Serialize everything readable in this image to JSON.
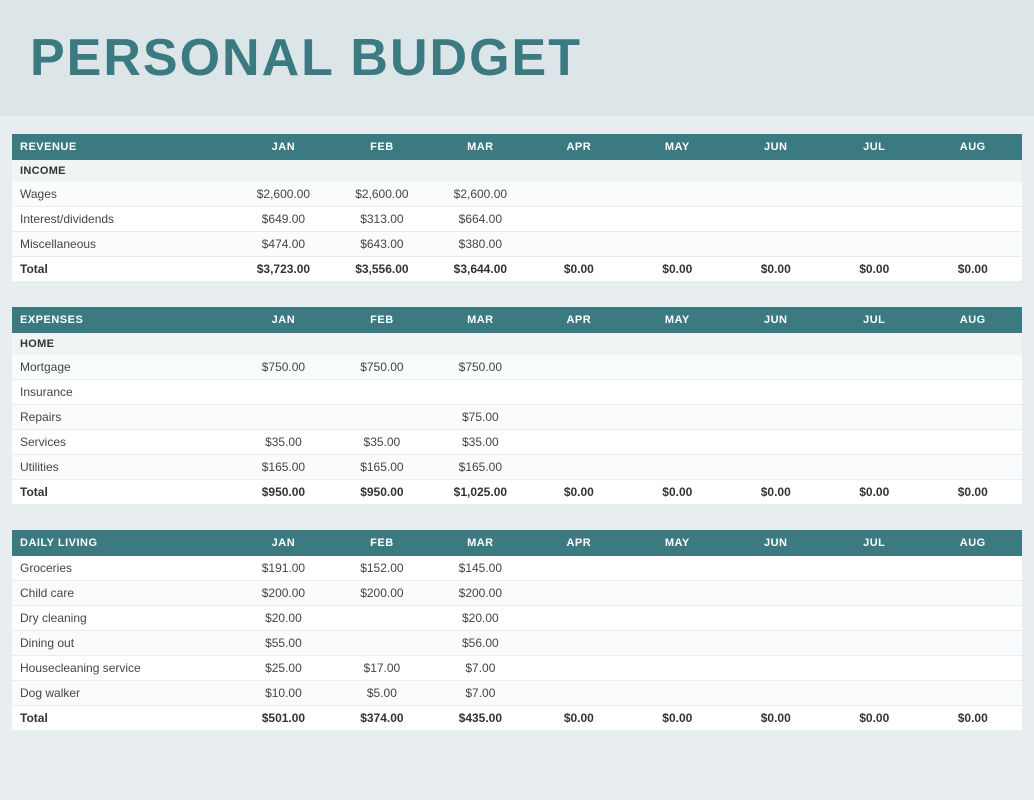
{
  "title": "PERSONAL BUDGET",
  "revenue": {
    "section_label": "REVENUE",
    "columns": [
      "REVENUE",
      "JAN",
      "FEB",
      "MAR",
      "APR",
      "MAY",
      "JUN",
      "JUL",
      "AUG"
    ],
    "income_subheader": "INCOME",
    "rows": [
      {
        "label": "Wages",
        "jan": "$2,600.00",
        "feb": "$2,600.00",
        "mar": "$2,600.00",
        "apr": "",
        "may": "",
        "jun": "",
        "jul": "",
        "aug": ""
      },
      {
        "label": "Interest/dividends",
        "jan": "$649.00",
        "feb": "$313.00",
        "mar": "$664.00",
        "apr": "",
        "may": "",
        "jun": "",
        "jul": "",
        "aug": ""
      },
      {
        "label": "Miscellaneous",
        "jan": "$474.00",
        "feb": "$643.00",
        "mar": "$380.00",
        "apr": "",
        "may": "",
        "jun": "",
        "jul": "",
        "aug": ""
      }
    ],
    "total": {
      "label": "Total",
      "jan": "$3,723.00",
      "feb": "$3,556.00",
      "mar": "$3,644.00",
      "apr": "$0.00",
      "may": "$0.00",
      "jun": "$0.00",
      "jul": "$0.00",
      "aug": "$0.00"
    }
  },
  "expenses": {
    "section_label": "EXPENSES",
    "columns": [
      "EXPENSES",
      "JAN",
      "FEB",
      "MAR",
      "APR",
      "MAY",
      "JUN",
      "JUL",
      "AUG"
    ],
    "home_subheader": "HOME",
    "rows": [
      {
        "label": "Mortgage",
        "jan": "$750.00",
        "feb": "$750.00",
        "mar": "$750.00",
        "apr": "",
        "may": "",
        "jun": "",
        "jul": "",
        "aug": ""
      },
      {
        "label": "Insurance",
        "jan": "",
        "feb": "",
        "mar": "",
        "apr": "",
        "may": "",
        "jun": "",
        "jul": "",
        "aug": ""
      },
      {
        "label": "Repairs",
        "jan": "",
        "feb": "",
        "mar": "$75.00",
        "apr": "",
        "may": "",
        "jun": "",
        "jul": "",
        "aug": ""
      },
      {
        "label": "Services",
        "jan": "$35.00",
        "feb": "$35.00",
        "mar": "$35.00",
        "apr": "",
        "may": "",
        "jun": "",
        "jul": "",
        "aug": ""
      },
      {
        "label": "Utilities",
        "jan": "$165.00",
        "feb": "$165.00",
        "mar": "$165.00",
        "apr": "",
        "may": "",
        "jun": "",
        "jul": "",
        "aug": ""
      }
    ],
    "total": {
      "label": "Total",
      "jan": "$950.00",
      "feb": "$950.00",
      "mar": "$1,025.00",
      "apr": "$0.00",
      "may": "$0.00",
      "jun": "$0.00",
      "jul": "$0.00",
      "aug": "$0.00"
    }
  },
  "daily_living": {
    "section_label": "DAILY LIVING",
    "columns": [
      "DAILY LIVING",
      "JAN",
      "FEB",
      "MAR",
      "APR",
      "MAY",
      "JUN",
      "JUL",
      "AUG"
    ],
    "rows": [
      {
        "label": "Groceries",
        "jan": "$191.00",
        "feb": "$152.00",
        "mar": "$145.00",
        "apr": "",
        "may": "",
        "jun": "",
        "jul": "",
        "aug": ""
      },
      {
        "label": "Child care",
        "jan": "$200.00",
        "feb": "$200.00",
        "mar": "$200.00",
        "apr": "",
        "may": "",
        "jun": "",
        "jul": "",
        "aug": ""
      },
      {
        "label": "Dry cleaning",
        "jan": "$20.00",
        "feb": "",
        "mar": "$20.00",
        "apr": "",
        "may": "",
        "jun": "",
        "jul": "",
        "aug": ""
      },
      {
        "label": "Dining out",
        "jan": "$55.00",
        "feb": "",
        "mar": "$56.00",
        "apr": "",
        "may": "",
        "jun": "",
        "jul": "",
        "aug": ""
      },
      {
        "label": "Housecleaning service",
        "jan": "$25.00",
        "feb": "$17.00",
        "mar": "$7.00",
        "apr": "",
        "may": "",
        "jun": "",
        "jul": "",
        "aug": ""
      },
      {
        "label": "Dog walker",
        "jan": "$10.00",
        "feb": "$5.00",
        "mar": "$7.00",
        "apr": "",
        "may": "",
        "jun": "",
        "jul": "",
        "aug": ""
      }
    ],
    "total": {
      "label": "Total",
      "jan": "$501.00",
      "feb": "$374.00",
      "mar": "$435.00",
      "apr": "$0.00",
      "may": "$0.00",
      "jun": "$0.00",
      "jul": "$0.00",
      "aug": "$0.00"
    }
  }
}
